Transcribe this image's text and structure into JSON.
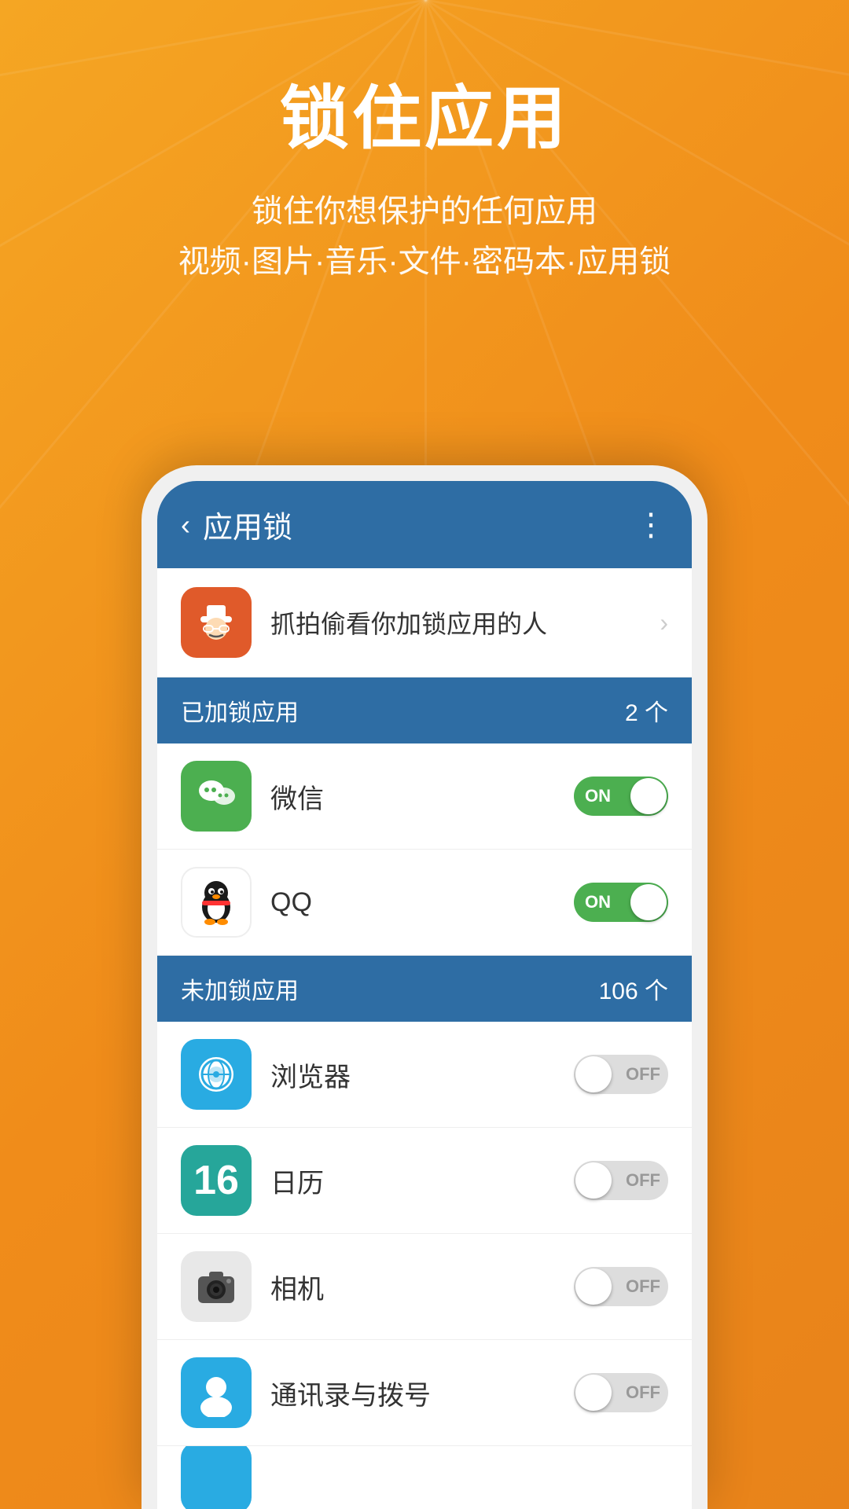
{
  "background": {
    "color": "#F5A623"
  },
  "header": {
    "main_title": "锁住应用",
    "subtitle_line1": "锁住你想保护的任何应用",
    "subtitle_line2": "视频·图片·音乐·文件·密码本·应用锁"
  },
  "app_bar": {
    "back_label": "‹",
    "title": "应用锁",
    "more_icon": "⋮"
  },
  "spy_row": {
    "text": "抓拍偷看你加锁应用的人",
    "chevron": "›"
  },
  "locked_section": {
    "title": "已加锁应用",
    "count": "2 个"
  },
  "locked_apps": [
    {
      "name": "微信",
      "icon_type": "wechat",
      "toggle": "ON"
    },
    {
      "name": "QQ",
      "icon_type": "qq",
      "toggle": "ON"
    }
  ],
  "unlocked_section": {
    "title": "未加锁应用",
    "count": "106 个"
  },
  "unlocked_apps": [
    {
      "name": "浏览器",
      "icon_type": "browser",
      "toggle": "OFF"
    },
    {
      "name": "日历",
      "icon_type": "calendar",
      "toggle": "OFF",
      "calendar_number": "16"
    },
    {
      "name": "相机",
      "icon_type": "camera",
      "toggle": "OFF"
    },
    {
      "name": "通讯录与拨号",
      "icon_type": "contacts",
      "toggle": "OFF"
    }
  ],
  "partial_row": {
    "icon_type": "partial_blue"
  }
}
